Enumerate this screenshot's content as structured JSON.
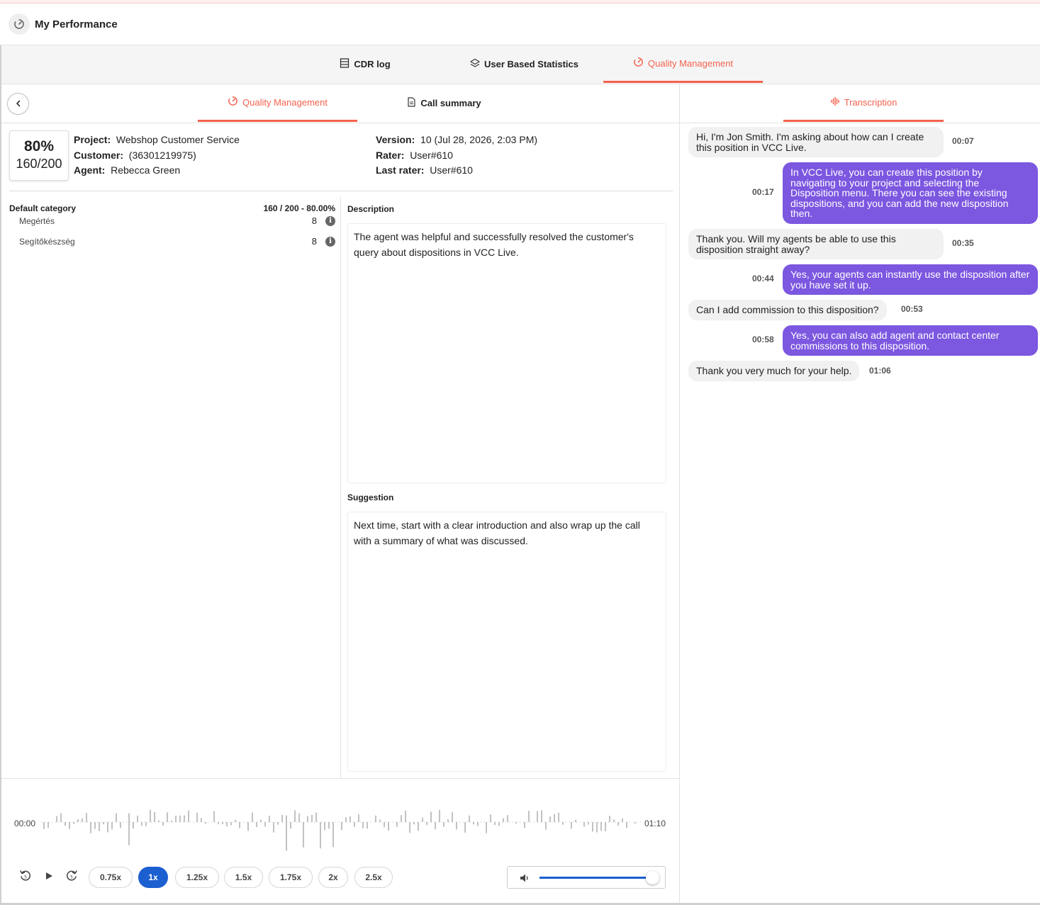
{
  "app": {
    "title": "My Performance"
  },
  "main_tabs": [
    {
      "label": "CDR log",
      "icon": "list-icon"
    },
    {
      "label": "User Based Statistics",
      "icon": "layers-icon"
    },
    {
      "label": "Quality Management",
      "icon": "gauge-icon"
    }
  ],
  "sub_tabs": [
    {
      "label": "Quality Management",
      "icon": "gauge-icon"
    },
    {
      "label": "Call summary",
      "icon": "document-icon"
    }
  ],
  "score": {
    "percent": "80%",
    "fraction": "160/200"
  },
  "info": {
    "project_label": "Project:",
    "project": "Webshop Customer Service",
    "customer_label": "Customer:",
    "customer": "(36301219975)",
    "agent_label": "Agent:",
    "agent": "Rebecca Green",
    "version_label": "Version:",
    "version": "10 (Jul 28, 2026, 2:03 PM)",
    "rater_label": "Rater:",
    "rater": "User#610",
    "last_rater_label": "Last rater:",
    "last_rater": "User#610"
  },
  "category": {
    "name": "Default category",
    "total": "160 / 200 - 80.00%",
    "criteria": [
      {
        "name": "Megértés",
        "value": "8"
      },
      {
        "name": "Segítőkészség",
        "value": "8"
      }
    ]
  },
  "description": {
    "label": "Description",
    "text": "The agent was helpful and successfully resolved the customer's query about dispositions in VCC Live."
  },
  "suggestion": {
    "label": "Suggestion",
    "text": "Next time, start with a clear introduction and also wrap up the call with a summary of what was discussed."
  },
  "player": {
    "start_time": "00:00",
    "end_time": "01:10",
    "speeds": [
      "0.75x",
      "1x",
      "1.25x",
      "1.5x",
      "1.75x",
      "2x",
      "2.5x"
    ],
    "active_speed": "1x",
    "volume": 1.0
  },
  "transcription": {
    "tab_label": "Transcription",
    "messages": [
      {
        "speaker": "customer",
        "text": "Hi, I'm Jon Smith. I'm asking about how can I create this position in VCC Live.",
        "time": "00:07"
      },
      {
        "speaker": "agent",
        "text": "In VCC Live, you can create this position by navigating to your project and selecting the Disposition menu. There you can see the existing dispositions, and you can add the new disposition then.",
        "time": "00:17"
      },
      {
        "speaker": "customer",
        "text": "Thank you. Will my agents be able to use this disposition straight away?",
        "time": "00:35"
      },
      {
        "speaker": "agent",
        "text": "Yes, your agents can instantly use the disposition after you have set it up.",
        "time": "00:44"
      },
      {
        "speaker": "customer",
        "text": "Can I add commission to this disposition?",
        "time": "00:53"
      },
      {
        "speaker": "agent",
        "text": "Yes, you can also add agent and contact center commissions to this disposition.",
        "time": "00:58"
      },
      {
        "speaker": "customer",
        "text": "Thank you very much for your help.",
        "time": "01:06"
      }
    ]
  },
  "colors": {
    "accent": "#f4624e",
    "agent_bubble": "#7c57e0",
    "customer_bubble": "#f1f1f1",
    "active_speed": "#1c5fd0"
  }
}
